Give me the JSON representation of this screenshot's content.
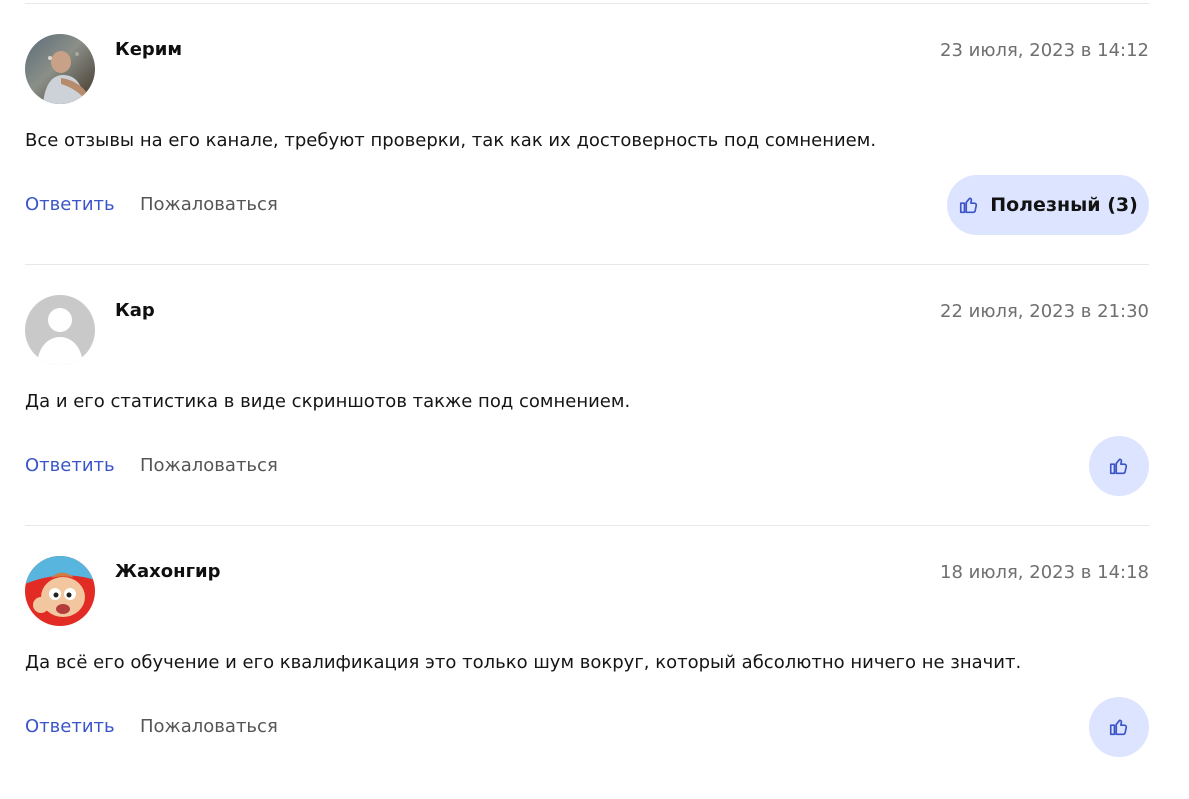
{
  "comments": [
    {
      "author": "Керим",
      "date": "23 июля, 2023 в 14:12",
      "text": "Все отзывы на его канале, требуют проверки, так как их достоверность под сомнением.",
      "reply_label": "Ответить",
      "report_label": "Пожаловаться",
      "helpful_label": "Полезный (3)"
    },
    {
      "author": "Кар",
      "date": "22 июля, 2023 в 21:30",
      "text": "Да и его статистика в виде скриншотов также под сомнением.",
      "reply_label": "Ответить",
      "report_label": "Пожаловаться"
    },
    {
      "author": "Жахонгир",
      "date": "18 июля, 2023 в 14:18",
      "text": "Да всё его обучение и его квалификация это только шум вокруг, который абсолютно ничего не значит.",
      "reply_label": "Ответить",
      "report_label": "Пожаловаться"
    }
  ],
  "colors": {
    "link": "#3b55c9",
    "muted": "#6f6f6f",
    "like_bg": "#dde4ff",
    "divider": "#e8e8e8"
  },
  "icons": {
    "like": "thumb-up-icon"
  }
}
